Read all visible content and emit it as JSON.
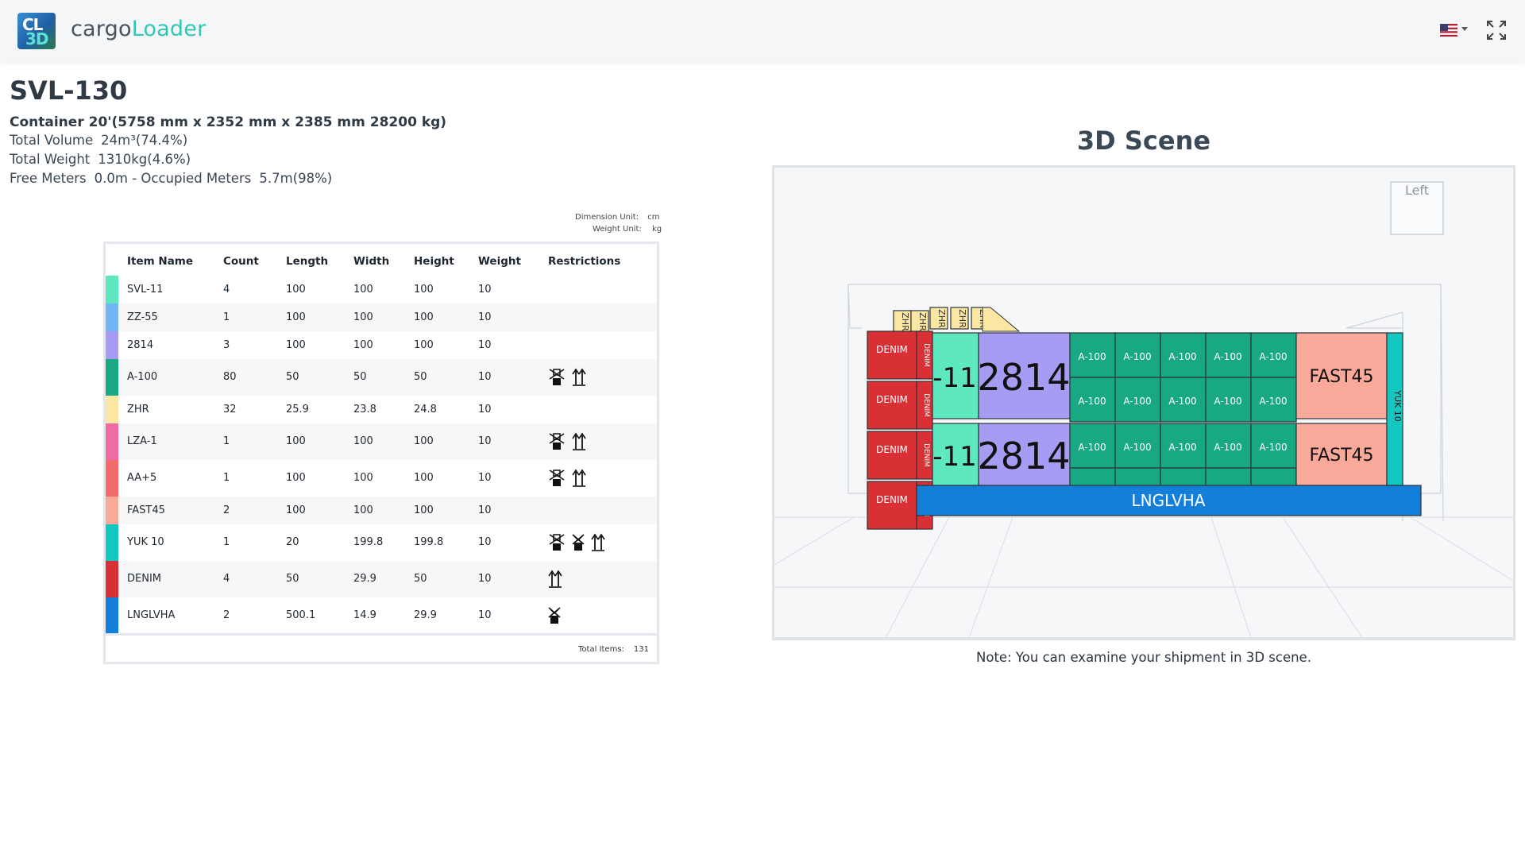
{
  "app": {
    "logo_top": "CL",
    "logo_bottom": "3D",
    "brand_part1": "cargo",
    "brand_part2": "Loader",
    "accent_color": "#2fc7b5",
    "language_icon": "us-flag-icon",
    "fullscreen_icon": "expand-icon"
  },
  "shipment": {
    "title": "SVL-130",
    "container": "Container 20'(5758 mm x 2352 mm x 2385 mm 28200 kg)",
    "total_volume_label": "Total Volume",
    "total_volume_value": "24m³(74.4%)",
    "total_weight_label": "Total Weight",
    "total_weight_value": "1310kg(4.6%)",
    "free_meters_label": "Free Meters",
    "free_meters_value": "0.0m - Occupied Meters",
    "occupied_meters_value": "5.7m(98%)"
  },
  "units": {
    "dimension_label": "Dimension Unit:",
    "dimension_value": "cm",
    "weight_label": "Weight Unit:",
    "weight_value": "kg"
  },
  "table": {
    "headers": [
      "Item Name",
      "Count",
      "Length",
      "Width",
      "Height",
      "Weight",
      "Restrictions"
    ],
    "rows": [
      {
        "name": "SVL-11",
        "count": "4",
        "length": "100",
        "width": "100",
        "height": "100",
        "weight": "10",
        "color": "#5ee8c0",
        "restrictions": []
      },
      {
        "name": "ZZ-55",
        "count": "1",
        "length": "100",
        "width": "100",
        "height": "100",
        "weight": "10",
        "color": "#74b6f5",
        "restrictions": []
      },
      {
        "name": "2814",
        "count": "3",
        "length": "100",
        "width": "100",
        "height": "100",
        "weight": "10",
        "color": "#a79cf3",
        "restrictions": []
      },
      {
        "name": "A-100",
        "count": "80",
        "length": "50",
        "width": "50",
        "height": "50",
        "weight": "10",
        "color": "#18a982",
        "restrictions": [
          "no-stack",
          "this-way-up"
        ]
      },
      {
        "name": "ZHR",
        "count": "32",
        "length": "25.9",
        "width": "23.8",
        "height": "24.8",
        "weight": "10",
        "color": "#fbe7a4",
        "restrictions": []
      },
      {
        "name": "LZA-1",
        "count": "1",
        "length": "100",
        "width": "100",
        "height": "100",
        "weight": "10",
        "color": "#f06aa6",
        "restrictions": [
          "no-stack",
          "this-way-up"
        ]
      },
      {
        "name": "AA+5",
        "count": "1",
        "length": "100",
        "width": "100",
        "height": "100",
        "weight": "10",
        "color": "#f36b6b",
        "restrictions": [
          "no-stack",
          "this-way-up"
        ]
      },
      {
        "name": "FAST45",
        "count": "2",
        "length": "100",
        "width": "100",
        "height": "100",
        "weight": "10",
        "color": "#f8a99a",
        "restrictions": []
      },
      {
        "name": "YUK 10",
        "count": "1",
        "length": "20",
        "width": "199.8",
        "height": "199.8",
        "weight": "10",
        "color": "#14c7c0",
        "restrictions": [
          "no-stack",
          "no-top-load",
          "this-way-up"
        ]
      },
      {
        "name": "DENIM",
        "count": "4",
        "length": "50",
        "width": "29.9",
        "height": "50",
        "weight": "10",
        "color": "#d93036",
        "restrictions": [
          "this-way-up"
        ]
      },
      {
        "name": "LNGLVHA",
        "count": "2",
        "length": "500.1",
        "width": "14.9",
        "height": "29.9",
        "weight": "10",
        "color": "#137fd9",
        "restrictions": [
          "no-top-load"
        ]
      }
    ],
    "total_label": "Total Items:",
    "total_value": "131"
  },
  "scene": {
    "title": "3D Scene",
    "viewcube_label": "Left",
    "note": "Note: You can examine your shipment in 3D scene.",
    "labels": {
      "denim": "DENIM",
      "svl": "-11",
      "n2814": "2814",
      "a100": "A-100",
      "fast45": "FAST45",
      "yuk": "YUK 10",
      "lnglvha": "LNGLVHA",
      "zhr": "ZHR"
    },
    "colors": {
      "denim": "#d93036",
      "svl": "#5ee8c0",
      "n2814": "#a79cf3",
      "a100": "#18a982",
      "fast45": "#f8a99a",
      "yuk": "#14c7c0",
      "lnglvha": "#137fd9",
      "zhr": "#fbe7a4"
    }
  }
}
